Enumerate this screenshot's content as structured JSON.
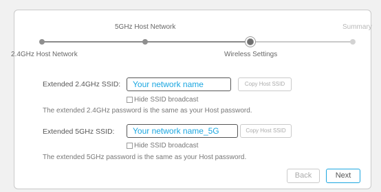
{
  "stepper": {
    "steps": [
      {
        "label": "2.4GHz Host Network",
        "state": "done"
      },
      {
        "label": "5GHz Host Network",
        "state": "done"
      },
      {
        "label": "Wireless Settings",
        "state": "current"
      },
      {
        "label": "Summary",
        "state": "upcoming"
      }
    ]
  },
  "form": {
    "ssid_24": {
      "label": "Extended 2.4GHz SSID:",
      "value": "Your network name",
      "copy_label": "Copy Host SSID",
      "hide_label": "Hide SSID broadcast",
      "note": "The extended 2.4GHz password is the same as your Host password."
    },
    "ssid_5": {
      "label": "Extended 5GHz SSID:",
      "value": "Your network name_5G",
      "copy_label": "Copy Host SSID",
      "hide_label": "Hide SSID broadcast",
      "note": "The extended 5GHz password is the same as your Host password."
    }
  },
  "buttons": {
    "back": "Back",
    "next": "Next"
  },
  "colors": {
    "accent": "#1aa6e0",
    "border": "#c9c9c9"
  }
}
